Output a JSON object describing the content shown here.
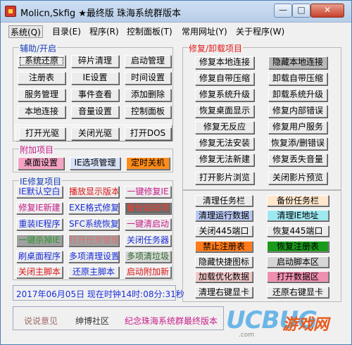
{
  "window": {
    "title": "Molicn,Skfig ★最终版 珠海系统群版本",
    "controls": {
      "minimize": "—",
      "maximize": "□",
      "close": "✕"
    }
  },
  "menu": [
    "系统(Q)",
    "目录(E)",
    "程序(R)",
    "控制面板(T)",
    "常用网址(Y)",
    "关于程序(W)"
  ],
  "sections": {
    "aux": "辅助/开启",
    "repair": "修复/卸载项目",
    "extra": "附加项目",
    "ie": "IE修复项目"
  },
  "aux_buttons": [
    "系统还原",
    "碎片清理",
    "启动管理",
    "注册表",
    "IE设置",
    "时间设置",
    "服务管理",
    "事件查看",
    "添加删除",
    "本地连接",
    "音量设置",
    "控制面板"
  ],
  "drive_buttons": [
    "打开光驱",
    "关闭光驱",
    "打开DOS"
  ],
  "extra_buttons": [
    "桌面设置",
    "IE选项管理",
    "定时关机"
  ],
  "ie_buttons": [
    "IE默认空白",
    "播放显示版本",
    "一键修复IE",
    "修复IE新建",
    "EXE格式修复",
    "备份启动项",
    "重装IE程序",
    "SFC系统恢复",
    "一键清启动",
    "一键杀掉IE",
    "打开任务管理",
    "关闭任务器",
    "刷桌面程序",
    "多项清理设置",
    "多项清垃圾",
    "关闭主脚本",
    "还原主脚本",
    "启动附加新"
  ],
  "repair_buttons": [
    "修复本地连接",
    "隐藏本地连接",
    "修复自带压缩",
    "卸载自带压缩",
    "修复系统升级",
    "卸载系统升级",
    "恢复桌面显示",
    "修复内部错误",
    "修复无反应",
    "修复用户服务",
    "修复无法安装",
    "恢复添/删错误",
    "修复无法新建",
    "修复丢失音量",
    "打开影片浏览",
    "关闭影片预览"
  ],
  "task_buttons": [
    "清理任务栏",
    "备份任务栏",
    "清理运行数据",
    "清理IE地址",
    "关闭445端口",
    "恢复445端口",
    "禁止注册表",
    "恢复注册表",
    "隐藏快捷图标",
    "启动脚本区",
    "加载优化数据",
    "打开数据区",
    "清理右键显卡",
    "还原右键显卡"
  ],
  "status": "2017年06月05日  现在时钟14时:08分:31秒",
  "footer": {
    "feedback": "说说意见",
    "community": "绅博社区",
    "memorial": "纪念珠海系统群最终版本"
  },
  "watermark": {
    "brand": "UCBUG",
    "cn": "游戏网",
    "url": ".com"
  }
}
